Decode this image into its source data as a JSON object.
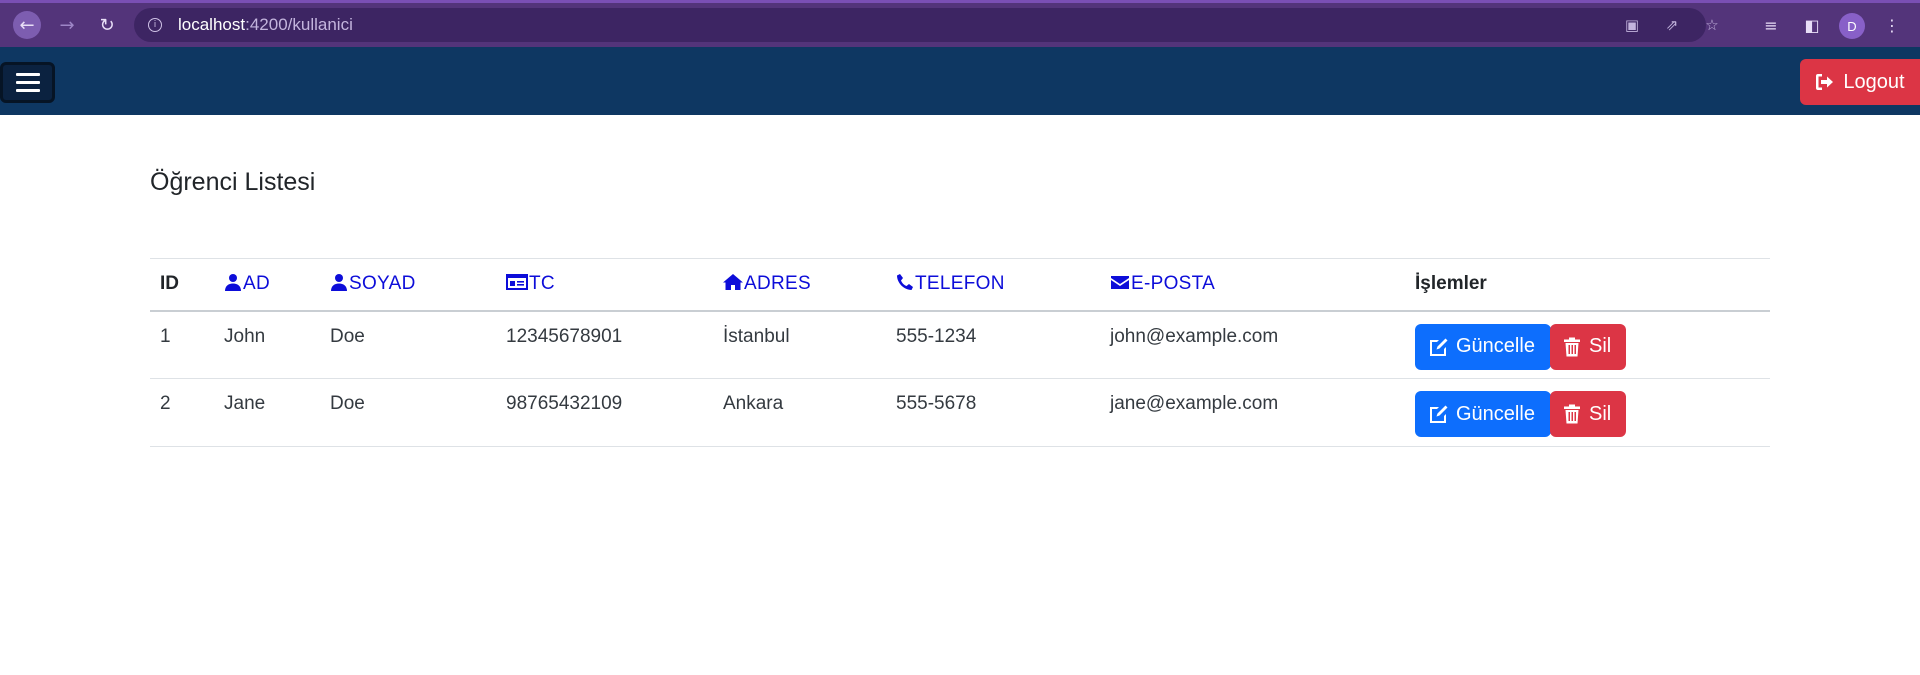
{
  "browser": {
    "url_host": "localhost",
    "url_path": ":4200/kullanici",
    "profile_initial": "D"
  },
  "navbar": {
    "logout_label": "Logout"
  },
  "page": {
    "title": "Öğrenci Listesi"
  },
  "table": {
    "headers": {
      "id": "ID",
      "ad": "AD",
      "soyad": "SOYAD",
      "tc": "TC",
      "adres": "ADRES",
      "telefon": "TELEFON",
      "eposta": "E-POSTA",
      "islemler": "İşlemler"
    },
    "rows": [
      {
        "id": "1",
        "ad": "John",
        "soyad": "Doe",
        "tc": "12345678901",
        "adres": "İstanbul",
        "telefon": "555-1234",
        "eposta": "john@example.com"
      },
      {
        "id": "2",
        "ad": "Jane",
        "soyad": "Doe",
        "tc": "98765432109",
        "adres": "Ankara",
        "telefon": "555-5678",
        "eposta": "jane@example.com"
      }
    ],
    "update_label": "Güncelle",
    "delete_label": "Sil"
  },
  "colors": {
    "browser_bar": "#53347a",
    "navbar": "#0e3762",
    "header_icon_blue": "#0d0dd9",
    "primary": "#0d6efd",
    "danger": "#dc3545"
  }
}
